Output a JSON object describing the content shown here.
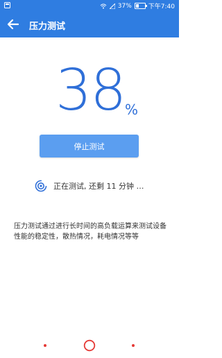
{
  "status_bar": {
    "signal": "37%",
    "battery_level": 0.37,
    "time": "下午7:40"
  },
  "app_bar": {
    "title": "压力测试",
    "back_icon": "arrow-left-icon"
  },
  "progress": {
    "value": "38",
    "unit": "%"
  },
  "actions": {
    "stop_label": "停止测试"
  },
  "status": {
    "icon": "loading-spinner-icon",
    "text": "正在测试, 还剩 11 分钟 …"
  },
  "description": "压力测试通过进行长时间的高负载运算来测试设备性能的稳定性，散热情况，耗电情况等等",
  "colors": {
    "primary": "#2f7de1",
    "button": "#5b9ef0",
    "nav_accent": "#e53935"
  }
}
